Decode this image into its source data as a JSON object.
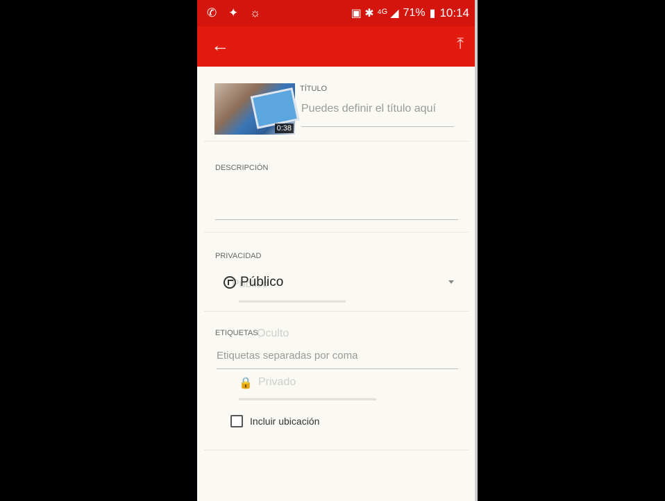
{
  "status_bar": {
    "left_icons": "✆ ✦ ☼",
    "right_icons": "▣ ✱ ⁴ᴳ ◢",
    "battery": "71%",
    "time": "10:14"
  },
  "app_bar": {
    "back_icon": "back-arrow-icon",
    "upload_icon": "upload-icon"
  },
  "video": {
    "duration": "0:38"
  },
  "titulo": {
    "label": "TÍTULO",
    "placeholder": "Puedes definir el título aquí"
  },
  "descripcion": {
    "label": "DESCRIPCIÓN"
  },
  "privacidad": {
    "label": "PRIVACIDAD",
    "selected": "Público",
    "ghost_options": [
      "Público",
      "Oculto",
      "Privado"
    ]
  },
  "etiquetas": {
    "label": "ETIQUETAS",
    "placeholder": "Etiquetas separadas por coma"
  },
  "ubicacion": {
    "label": "Incluir ubicación",
    "checked": false
  },
  "colors": {
    "status_bar": "#d3150d",
    "app_bar": "#e31b0f",
    "background": "#faf9f4"
  }
}
